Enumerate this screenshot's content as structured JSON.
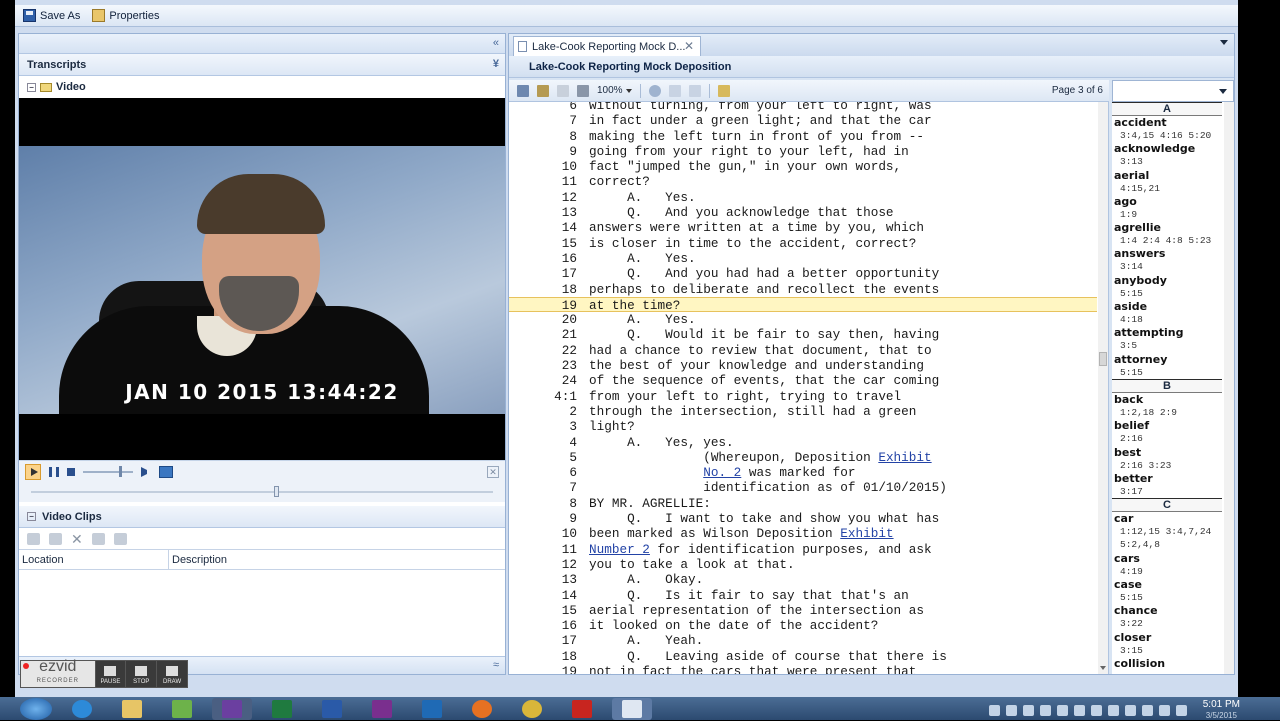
{
  "toolbar": {
    "save_as": "Save As",
    "properties": "Properties"
  },
  "left_panel": {
    "transcripts_header": "Transcripts",
    "video_node": "Video",
    "video_timestamp": "JAN 10 2015 13:44:22",
    "video_clips_label": "Video Clips",
    "clips_columns": [
      "Location",
      "Description"
    ]
  },
  "document": {
    "tab_label": "Lake-Cook Reporting Mock D...",
    "title": "Lake-Cook Reporting Mock Deposition",
    "zoom": "100%",
    "page_info": "Page 3 of 6",
    "lines": [
      {
        "n": "6",
        "t": "without turning, from your left to right, was"
      },
      {
        "n": "7",
        "t": "in fact under a green light; and that the car"
      },
      {
        "n": "8",
        "t": "making the left turn in front of you from --"
      },
      {
        "n": "9",
        "t": "going from your right to your left, had in"
      },
      {
        "n": "10",
        "t": "fact \"jumped the gun,\" in your own words,"
      },
      {
        "n": "11",
        "t": "correct?"
      },
      {
        "n": "12",
        "t": "     A.   Yes."
      },
      {
        "n": "13",
        "t": "     Q.   And you acknowledge that those"
      },
      {
        "n": "14",
        "t": "answers were written at a time by you, which"
      },
      {
        "n": "15",
        "t": "is closer in time to the accident, correct?"
      },
      {
        "n": "16",
        "t": "     A.   Yes."
      },
      {
        "n": "17",
        "t": "     Q.   And you had had a better opportunity"
      },
      {
        "n": "18",
        "t": "perhaps to deliberate and recollect the events"
      },
      {
        "n": "19",
        "t": "at the time?",
        "hl": true
      },
      {
        "n": "20",
        "t": "     A.   Yes."
      },
      {
        "n": "21",
        "t": "     Q.   Would it be fair to say then, having"
      },
      {
        "n": "22",
        "t": "had a chance to review that document, that to"
      },
      {
        "n": "23",
        "t": "the best of your knowledge and understanding"
      },
      {
        "n": "24",
        "t": "of the sequence of events, that the car coming"
      },
      {
        "n": "4:1",
        "t": "from your left to right, trying to travel"
      },
      {
        "n": "2",
        "t": "through the intersection, still had a green"
      },
      {
        "n": "3",
        "t": "light?"
      },
      {
        "n": "4",
        "t": "     A.   Yes, yes."
      },
      {
        "n": "5",
        "t": "               (Whereupon, Deposition ",
        "link": "Exhibit"
      },
      {
        "n": "6",
        "t": "",
        "pre": "               ",
        "link": "No. 2",
        "post": " was marked for"
      },
      {
        "n": "7",
        "t": "               identification as of 01/10/2015)"
      },
      {
        "n": "8",
        "t": "BY MR. AGRELLIE:"
      },
      {
        "n": "9",
        "t": "     Q.   I want to take and show you what has"
      },
      {
        "n": "10",
        "t": "been marked as Wilson Deposition ",
        "link": "Exhibit"
      },
      {
        "n": "11",
        "t": "",
        "pre": "",
        "link": "Number 2",
        "post": " for identification purposes, and ask"
      },
      {
        "n": "12",
        "t": "you to take a look at that."
      },
      {
        "n": "13",
        "t": "     A.   Okay."
      },
      {
        "n": "14",
        "t": "     Q.   Is it fair to say that that's an"
      },
      {
        "n": "15",
        "t": "aerial representation of the intersection as"
      },
      {
        "n": "16",
        "t": "it looked on the date of the accident?"
      },
      {
        "n": "17",
        "t": "     A.   Yeah."
      },
      {
        "n": "18",
        "t": "     Q.   Leaving aside of course that there is"
      },
      {
        "n": "19",
        "t": "not in fact the cars that were present that"
      }
    ]
  },
  "index": {
    "sections": [
      {
        "letter": "A",
        "entries": [
          {
            "term": "accident",
            "refs": [
              "3:4,15 4:16 5:20"
            ]
          },
          {
            "term": "acknowledge",
            "refs": [
              "3:13"
            ]
          },
          {
            "term": "aerial",
            "refs": [
              "4:15,21"
            ]
          },
          {
            "term": "ago",
            "refs": [
              "1:9"
            ]
          },
          {
            "term": "agrellie",
            "refs": [
              "1:4 2:4 4:8 5:23"
            ]
          },
          {
            "term": "answers",
            "refs": [
              "3:14"
            ]
          },
          {
            "term": "anybody",
            "refs": [
              "5:15"
            ]
          },
          {
            "term": "aside",
            "refs": [
              "4:18"
            ]
          },
          {
            "term": "attempting",
            "refs": [
              "3:5"
            ]
          },
          {
            "term": "attorney",
            "refs": [
              "5:15"
            ]
          }
        ]
      },
      {
        "letter": "B",
        "entries": [
          {
            "term": "back",
            "refs": [
              "1:2,18 2:9"
            ]
          },
          {
            "term": "belief",
            "refs": [
              "2:16"
            ]
          },
          {
            "term": "best",
            "refs": [
              "2:16 3:23"
            ]
          },
          {
            "term": "better",
            "refs": [
              "3:17"
            ]
          }
        ]
      },
      {
        "letter": "C",
        "entries": [
          {
            "term": "car",
            "refs": [
              "1:12,15 3:4,7,24",
              "5:2,4,8"
            ]
          },
          {
            "term": "cars",
            "refs": [
              "4:19"
            ]
          },
          {
            "term": "case",
            "refs": [
              "5:15"
            ]
          },
          {
            "term": "chance",
            "refs": [
              "3:22"
            ]
          },
          {
            "term": "closer",
            "refs": [
              "3:15"
            ]
          },
          {
            "term": "collision",
            "refs": []
          }
        ]
      }
    ]
  },
  "ezvid": {
    "logo": "ezvid",
    "sub": "RECORDER",
    "buttons": [
      "PAUSE",
      "STOP",
      "DRAW"
    ]
  },
  "taskbar": {
    "time": "5:01 PM",
    "date": "3/5/2015"
  },
  "colors": {
    "highlight": "#fff6c2",
    "link": "#2343a6",
    "app_bg": "#cfdcef"
  }
}
